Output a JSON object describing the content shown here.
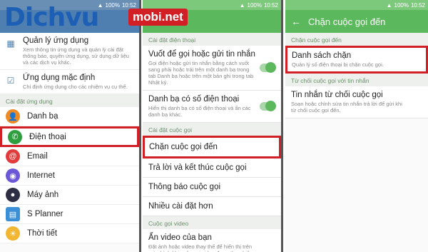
{
  "brand": {
    "name": "Dichvu",
    "badge": "mobi.net"
  },
  "status": {
    "signal": "100%",
    "time": "10:52"
  },
  "panel1": {
    "rows_top": [
      {
        "title": "Quản lý ứng dụng",
        "desc": "Xem thông tin ứng dụng và quản lý cài đặt thông báo, quyền ứng dụng, sử dụng dữ liệu và các dịch vụ khác."
      },
      {
        "title": "Ứng dụng mặc định",
        "desc": "Chỉ định ứng dụng cho các nhiệm vụ cụ thể."
      }
    ],
    "section": "Cài đặt ứng dụng",
    "apps": [
      {
        "label": "Danh bạ",
        "color": "#f08a24",
        "icon": "contacts-icon"
      },
      {
        "label": "Điện thoại",
        "color": "#2e9e3e",
        "icon": "phone-icon"
      },
      {
        "label": "Email",
        "color": "#e23b3b",
        "icon": "email-icon"
      },
      {
        "label": "Internet",
        "color": "#6b58d6",
        "icon": "internet-icon"
      },
      {
        "label": "Máy ảnh",
        "color": "#2e2e44",
        "icon": "camera-icon"
      },
      {
        "label": "S Planner",
        "color": "#3a8fd6",
        "icon": "calendar-icon"
      },
      {
        "label": "Thời tiết",
        "color": "#f2b632",
        "icon": "weather-icon"
      }
    ]
  },
  "panel2": {
    "section1": "Cài đặt điện thoại",
    "rows1": [
      {
        "title": "Vuốt để gọi hoặc gửi tin nhắn",
        "desc": "Gọi điện hoặc gửi tin nhắn bằng cách vuốt sang phải hoặc trái trên một danh bạ trong tab Danh bạ hoặc trên một bản ghi trong tab Nhật ký."
      },
      {
        "title": "Danh bạ có số điện thoại",
        "desc": "Hiển thị danh bạ có số điện thoại và ẩn các danh bạ khác."
      }
    ],
    "section2": "Cài đặt cuộc gọi",
    "rows2": [
      "Chặn cuộc gọi đến",
      "Trả lời và kết thúc cuộc gọi",
      "Thông báo cuộc gọi",
      "Nhiều cài đặt hơn"
    ],
    "section3": "Cuộc gọi video",
    "row_video": {
      "title": "Ẩn video của bạn",
      "desc": "Đặt ảnh hoặc video thay thế để hiển thị trên màn hình khi cuộc gọi video được thực hiện."
    }
  },
  "panel3": {
    "title": "Chặn cuộc gọi đến",
    "section1": "Chặn cuộc gọi đến",
    "row1": {
      "title": "Danh sách chặn",
      "desc": "Quản lý số điện thoại bị chặn cuộc gọi."
    },
    "section2": "Từ chối cuộc gọi với tin nhắn",
    "row2": {
      "title": "Tin nhắn từ chối cuộc gọi",
      "desc": "Soạn hoặc chỉnh sửa tin nhắn trả lời để gửi khi từ chối cuộc gọi đến."
    }
  }
}
